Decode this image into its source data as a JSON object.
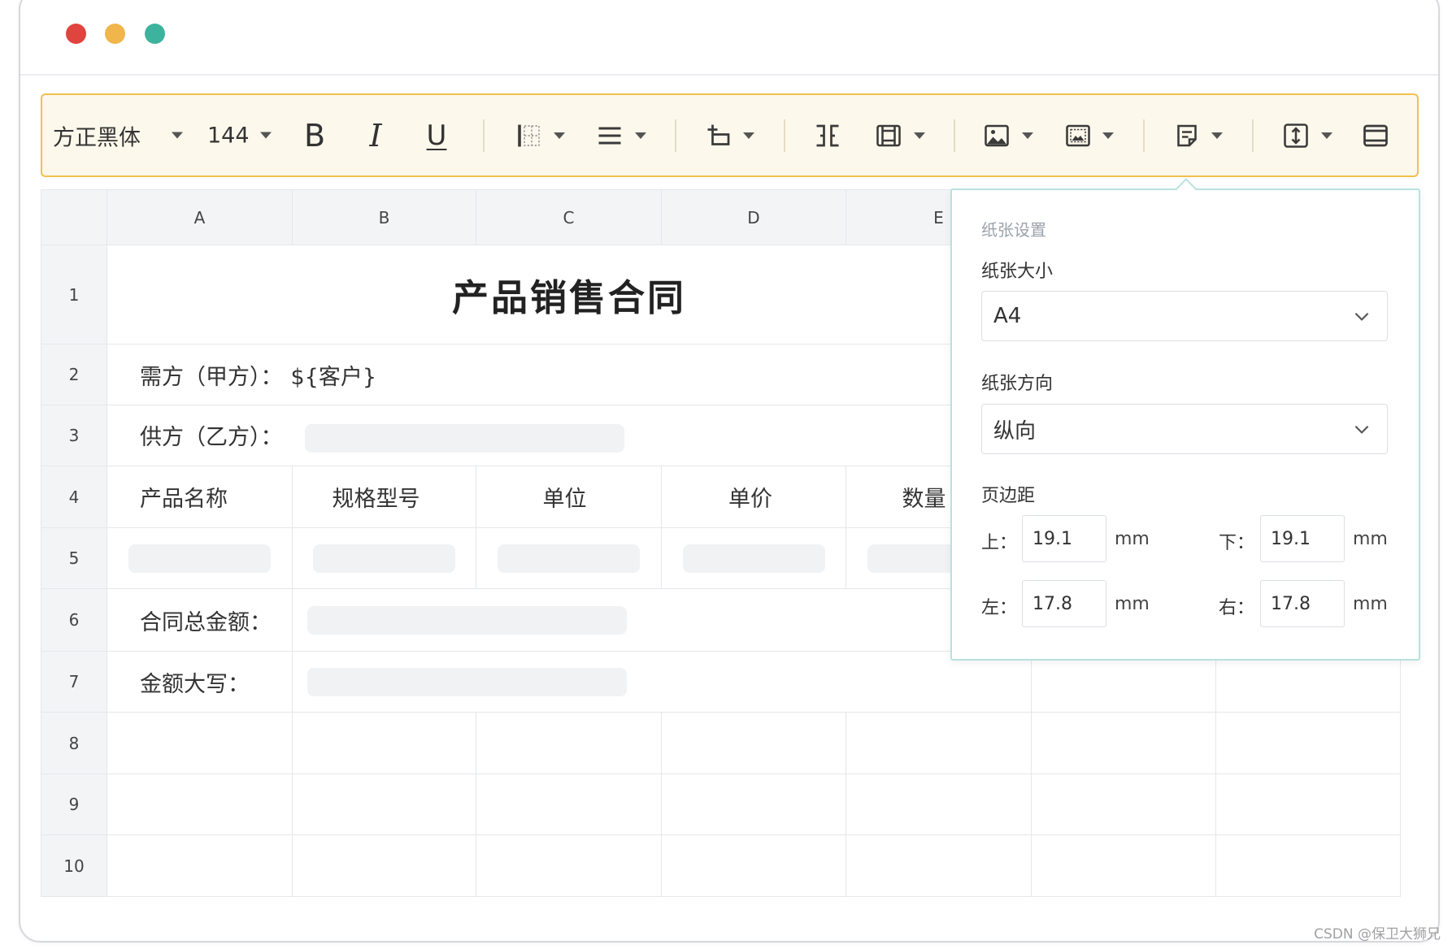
{
  "window": {
    "controls": [
      {
        "name": "close",
        "color": "#e0443e"
      },
      {
        "name": "minimize",
        "color": "#f0b54b"
      },
      {
        "name": "maximize",
        "color": "#3db39e"
      }
    ]
  },
  "toolbar": {
    "font_family": "方正黑体",
    "font_size": "144",
    "bold_label": "B",
    "italic_label": "I",
    "underline_label": "U",
    "icons": [
      "border-icon",
      "align-icon",
      "text-wrap-icon",
      "merge-cells-icon",
      "frame-icon",
      "image-icon",
      "background-image-icon",
      "page-setup-icon",
      "row-height-icon",
      "page-view-icon"
    ],
    "accent_border_color": "#f2c04f",
    "background_color": "#fdf8ec"
  },
  "sheet": {
    "columns": [
      "A",
      "B",
      "C",
      "D",
      "E"
    ],
    "row_numbers": [
      "1",
      "2",
      "3",
      "4",
      "5",
      "6",
      "7",
      "8",
      "9",
      "10"
    ],
    "title": "产品销售合同",
    "buyer_label": "需方（甲方）：",
    "buyer_value": "${客户}",
    "supplier_label": "供方（乙方）：",
    "item_headers": [
      "产品名称",
      "规格型号",
      "单位",
      "单价",
      "数量"
    ],
    "total_label": "合同总金额：",
    "amount_in_words_label": "金额大写："
  },
  "paper_settings": {
    "title": "纸张设置",
    "size_label": "纸张大小",
    "size_value": "A4",
    "orientation_label": "纸张方向",
    "orientation_value": "纵向",
    "margins_label": "页边距",
    "margins": {
      "top": {
        "label": "上：",
        "value": "19.1",
        "unit": "mm"
      },
      "bottom": {
        "label": "下：",
        "value": "19.1",
        "unit": "mm"
      },
      "left": {
        "label": "左：",
        "value": "17.8",
        "unit": "mm"
      },
      "right": {
        "label": "右：",
        "value": "17.8",
        "unit": "mm"
      }
    },
    "border_color": "#b8e1dd"
  },
  "watermark": "CSDN @保卫大狮兄"
}
